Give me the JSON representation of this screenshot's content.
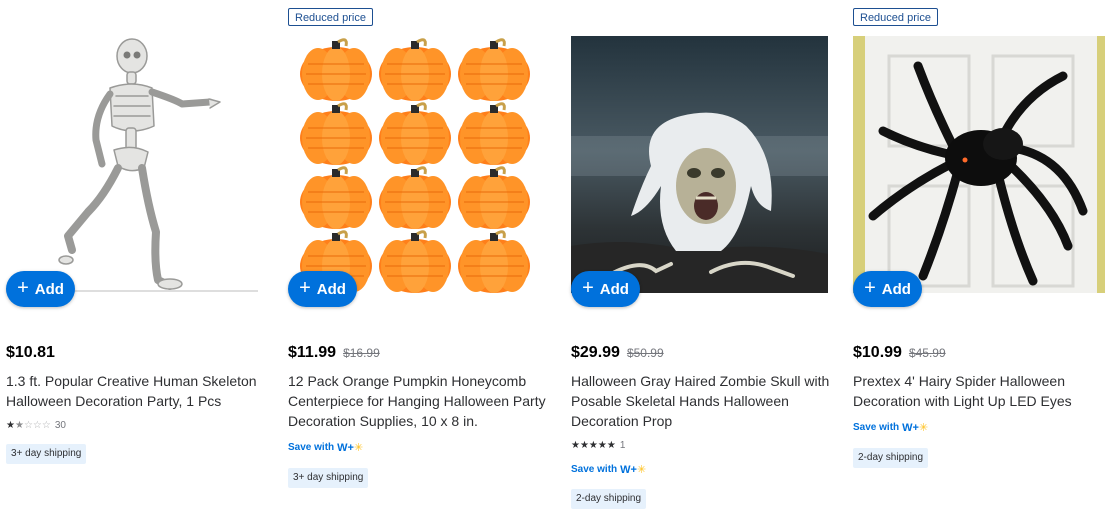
{
  "products": [
    {
      "flag": "",
      "image": "skeleton-image",
      "add_label": "Add",
      "price": "$10.81",
      "was_price": "",
      "title": "1.3 ft. Popular Creative Human Skeleton Halloween Decoration Party, 1 Pcs",
      "rating": {
        "stars": 1.5,
        "out_of": 5,
        "count": "30"
      },
      "save_with": "",
      "shipping": "3+ day shipping"
    },
    {
      "flag": "Reduced price",
      "image": "pumpkins-image",
      "add_label": "Add",
      "price": "$11.99",
      "was_price": "$16.99",
      "title": "12 Pack Orange Pumpkin Honeycomb Centerpiece for Hanging Halloween Party Decoration Supplies, 10 x 8 in.",
      "rating": null,
      "save_with": "Save with",
      "shipping": "3+ day shipping"
    },
    {
      "flag": "",
      "image": "zombie-skull-image",
      "add_label": "Add",
      "price": "$29.99",
      "was_price": "$50.99",
      "title": "Halloween Gray Haired Zombie Skull with Posable Skeletal Hands Halloween Decoration Prop",
      "rating": {
        "stars": 5,
        "out_of": 5,
        "count": "1"
      },
      "save_with": "Save with",
      "shipping": "2-day shipping"
    },
    {
      "flag": "Reduced price",
      "image": "spider-image",
      "add_label": "Add",
      "price": "$10.99",
      "was_price": "$45.99",
      "title": "Prextex 4' Hairy Spider Halloween Decoration with Light Up LED Eyes",
      "rating": null,
      "save_with": "Save with",
      "shipping": "2-day shipping"
    }
  ],
  "walmart_plus_label": "W+",
  "colors": {
    "accent": "#0071dc",
    "flag_border": "#1d4f91",
    "ship_bg": "#e6f1fc",
    "pumpkin": "#ff8a1c",
    "spark": "#ffc220"
  }
}
